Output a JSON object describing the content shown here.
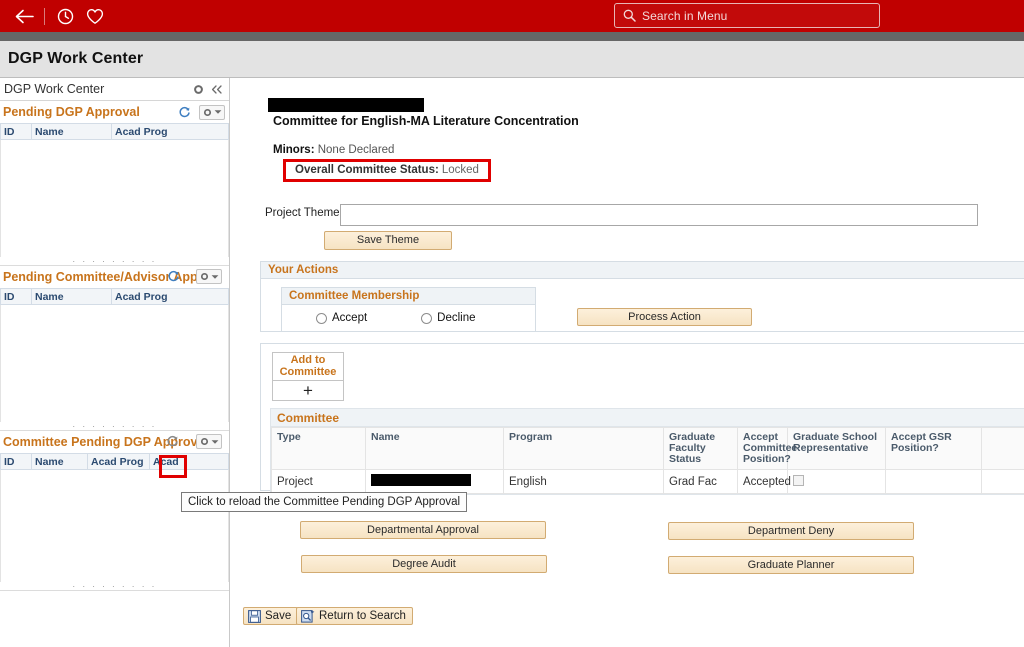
{
  "topbar": {
    "back_icon": "back-arrow-icon",
    "recent_icon": "clock-icon",
    "favorites_icon": "heart-icon",
    "search_placeholder": "Search in Menu",
    "search_value": "",
    "bar_color": "#c00000"
  },
  "page": {
    "title": "DGP Work Center"
  },
  "sidebar": {
    "header_title": "DGP Work Center",
    "groups": [
      {
        "title": "Pending DGP Approval",
        "columns": [
          "ID",
          "Name",
          "Acad Prog"
        ]
      },
      {
        "title": "Pending Committee/Advisor Appr",
        "columns": [
          "ID",
          "Name",
          "Acad Prog"
        ]
      },
      {
        "title": "Committee Pending DGP Approval",
        "columns": [
          "ID",
          "Name",
          "Acad Prog",
          "Acad"
        ]
      }
    ]
  },
  "tooltip": {
    "text": "Click to reload the Committee Pending DGP Approval"
  },
  "main": {
    "student_name": "",
    "committee_title": "Committee for English-MA Literature Concentration",
    "minors_label": "Minors:",
    "minors_value": "None Declared",
    "status_label": "Overall Committee Status:",
    "status_value": "Locked",
    "status_highlight_color": "#e00000",
    "project_theme_label": "Project Theme",
    "project_theme_value": "",
    "save_theme_label": "Save Theme",
    "your_actions": {
      "panel_title": "Your Actions",
      "membership_title": "Committee Membership",
      "accept_label": "Accept",
      "decline_label": "Decline",
      "accept_checked": false,
      "decline_checked": false,
      "process_action_label": "Process Action"
    },
    "add_to_committee": {
      "line1": "Add to",
      "line2": "Committee",
      "plus": "+"
    },
    "committee": {
      "section_title": "Committee",
      "columns": [
        "Type",
        "Name",
        "Program",
        "Graduate Faculty Status",
        "Accept Committee Position?",
        "Graduate School Representative",
        "Accept GSR Position?",
        ""
      ],
      "rows": [
        {
          "type": "Project",
          "name": "",
          "program": "English",
          "grad_faculty_status": "Grad Fac",
          "accept_committee_position": "Accepted",
          "gsr_checkbox": false,
          "accept_gsr_position": "",
          "extra": ""
        }
      ]
    },
    "buttons": {
      "departmental_approval": "Departmental Approval",
      "department_deny": "Department Deny",
      "degree_audit": "Degree Audit",
      "graduate_planner": "Graduate Planner",
      "save": "Save",
      "return_to_search": "Return to Search"
    }
  }
}
